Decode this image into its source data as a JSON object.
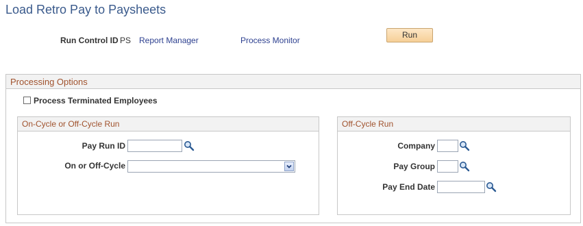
{
  "page": {
    "title": "Load Retro Pay to Paysheets"
  },
  "header": {
    "run_control_label": "Run Control ID",
    "run_control_value": "PS",
    "report_manager": "Report Manager",
    "process_monitor": "Process Monitor",
    "run_button": "Run"
  },
  "processing_options": {
    "title": "Processing Options",
    "process_terminated_label": "Process Terminated Employees",
    "process_terminated_checked": false,
    "on_cycle": {
      "title": "On-Cycle or Off-Cycle Run",
      "pay_run_id_label": "Pay Run ID",
      "pay_run_id_value": "",
      "on_off_cycle_label": "On or Off-Cycle",
      "on_off_cycle_value": ""
    },
    "off_cycle": {
      "title": "Off-Cycle Run",
      "company_label": "Company",
      "company_value": "",
      "pay_group_label": "Pay Group",
      "pay_group_value": "",
      "pay_end_date_label": "Pay End Date",
      "pay_end_date_value": ""
    }
  },
  "icons": {
    "lookup": "magnifier-lookup-icon",
    "dropdown": "chevron-down-icon"
  },
  "colors": {
    "title": "#3a5a8c",
    "group_title": "#a0522d",
    "link": "#2c3f8f",
    "run_button": "#f6cf97"
  }
}
